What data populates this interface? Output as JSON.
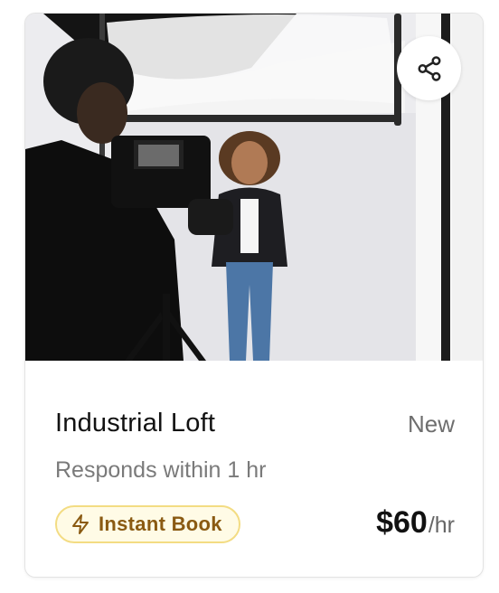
{
  "listing": {
    "title": "Industrial Loft",
    "status": "New",
    "responds": "Responds within 1 hr",
    "badge": "Instant Book",
    "price": "$60",
    "price_unit": "/hr"
  },
  "icons": {
    "share": "share-icon",
    "bolt": "lightning-bolt-icon"
  },
  "colors": {
    "badge_border": "#f3dc83",
    "badge_background": "#fffbe6",
    "badge_text": "#8a5a12",
    "muted_text": "#7a7a7a"
  }
}
